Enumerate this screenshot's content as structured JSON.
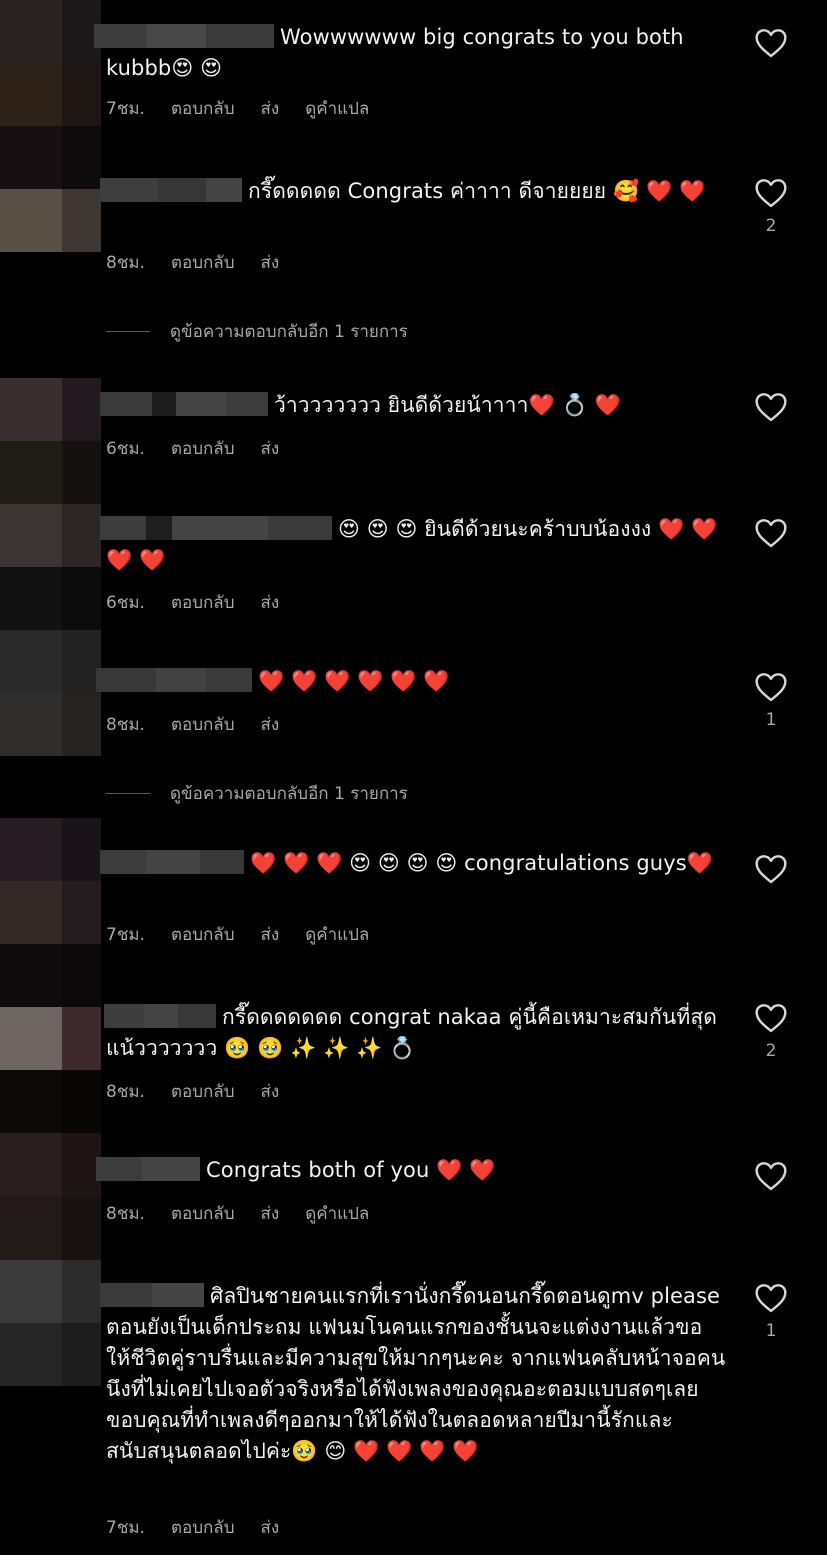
{
  "actions": {
    "reply": "ตอบกลับ",
    "send": "ส่ง",
    "translate": "ดูคำแปล"
  },
  "view_more_replies": "ดูข้อความตอบกลับอีก 1 รายการ",
  "comments": [
    {
      "text": "Wowwwwww big congrats to you both kubbb😍 😍",
      "time": "7ชม.",
      "likes": "",
      "has_translate": true
    },
    {
      "text": "กรี๊ดดดดด Congrats ค่าาาา ดีจายยยย 🥰 ❤️ ❤️",
      "time": "8ชม.",
      "likes": "2",
      "has_translate": false
    },
    {
      "text": "ว้าววววววว ยินดีด้วยน้าาาา❤️ 💍 ❤️",
      "time": "6ชม.",
      "likes": "",
      "has_translate": false
    },
    {
      "text": "😍 😍 😍 ยินดีด้วยนะคร้าบบน้องงง ❤️ ❤️ ❤️ ❤️",
      "time": "6ชม.",
      "likes": "",
      "has_translate": false
    },
    {
      "text": "❤️ ❤️ ❤️ ❤️ ❤️ ❤️",
      "time": "8ชม.",
      "likes": "1",
      "has_translate": false
    },
    {
      "text": "❤️ ❤️ ❤️ 😍 😍 😍 😍 congratulations guys❤️",
      "time": "7ชม.",
      "likes": "",
      "has_translate": true
    },
    {
      "text": "กรี๊ดดดดดดด congrat nakaa คู่นี้คือเหมาะสมกันที่สุดแน้ววววววว 🥹 🥹 ✨ ✨ ✨ 💍",
      "time": "8ชม.",
      "likes": "2",
      "has_translate": false
    },
    {
      "text": "Congrats both of you ❤️ ❤️",
      "time": "8ชม.",
      "likes": "",
      "has_translate": true
    },
    {
      "text": "ศิลปินชายคนแรกที่เรานั่งกรี๊ดนอนกรี๊ดตอนดูmv please ตอนยังเป็นเด็กประถม แฟนมโนคนแรกของชั้นนจะแต่งงานแล้วขอให้ชีวิตคู่ราบรื่นและมีความสุขให้มากๆนะคะ จากแฟนคลับหน้าจอคนนึงที่ไม่เคยไปเจอตัวจริงหรือได้ฟังเพลงของคุณอะตอมแบบสดๆเลย ขอบคุณที่ทำเพลงดีๆออกมาให้ได้ฟังในตลอดหลายปีมานี้รักและสนับสนุนตลอดไปค่ะ🥹 😊 ❤️ ❤️ ❤️ ❤️",
      "time": "7ชม.",
      "likes": "1",
      "has_translate": false
    }
  ]
}
